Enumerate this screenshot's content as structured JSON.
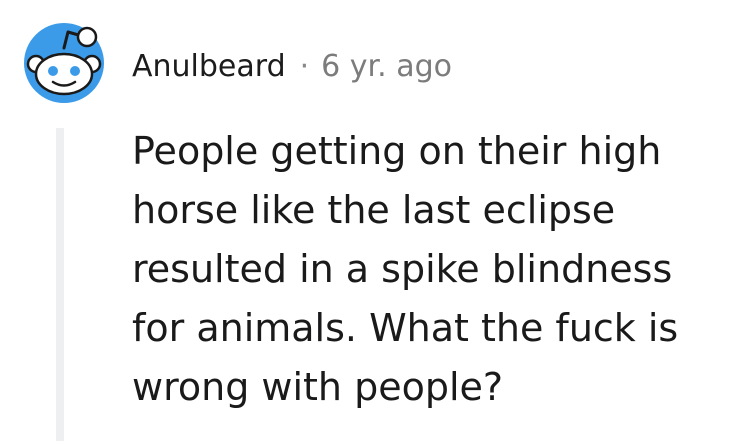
{
  "comment": {
    "username": "Anulbeard",
    "separator": "·",
    "timestamp": "6 yr. ago",
    "body": "People getting on their high horse like the last eclipse resulted in a spike blindness for animals. What the fuck is wrong with people?"
  },
  "icons": {
    "avatar": "reddit-snoo-avatar-icon"
  },
  "colors": {
    "avatar_bg": "#3b9be8",
    "thread_line": "#edeff1",
    "timestamp": "#7c7c7c"
  }
}
